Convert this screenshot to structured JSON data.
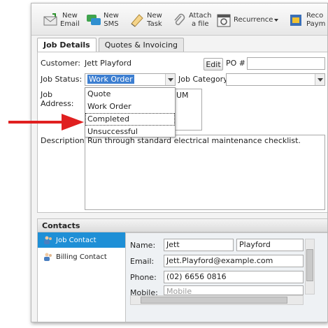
{
  "toolbar": {
    "new_email": "New\nEmail",
    "new_sms": "New\nSMS",
    "new_task": "New\nTask",
    "attach_file": "Attach\na file",
    "recurrence": "Recurrence",
    "receive_payment": "Reco\nPaym"
  },
  "tabs": [
    {
      "label": "Job Details",
      "active": true
    },
    {
      "label": "Quotes & Invoicing",
      "active": false
    }
  ],
  "form": {
    "customer_label": "Customer:",
    "customer_value": "Jett Playford",
    "edit_button": "Edit",
    "po_label": "PO #",
    "po_value": "",
    "job_status_label": "Job Status:",
    "job_status_value": "Work Order",
    "job_category_label": "Job Category",
    "job_category_value": "",
    "job_address_label": "Job\nAddress:",
    "job_address_partial": "UM",
    "description_label": "Description:",
    "description_value": "Run through standard electrical maintenance checklist."
  },
  "status_dropdown": {
    "options": [
      "Quote",
      "Work Order",
      "Completed",
      "Unsuccessful"
    ],
    "highlighted": "Completed"
  },
  "contacts": {
    "header": "Contacts",
    "items": [
      {
        "label": "Job Contact",
        "active": true
      },
      {
        "label": "Billing Contact",
        "active": false
      }
    ],
    "name_label": "Name:",
    "first_name": "Jett",
    "last_name": "Playford",
    "email_label": "Email:",
    "email_value": "Jett.Playford@example.com",
    "phone_label": "Phone:",
    "phone_value": "(02) 6656 0816",
    "mobile_label": "Mobile:",
    "mobile_placeholder": "Mobile"
  },
  "colors": {
    "accent": "#1e8fd6",
    "arrow": "#e02020",
    "selection": "#3d7fd1"
  }
}
